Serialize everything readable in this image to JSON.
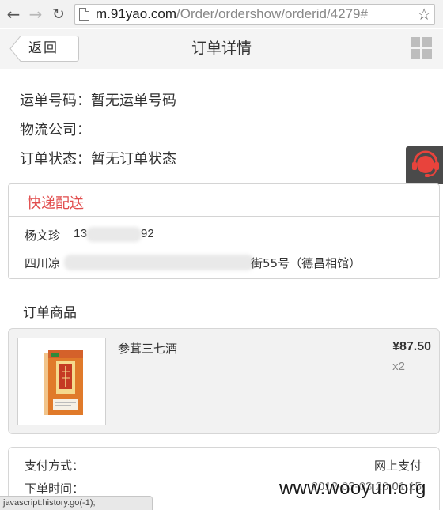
{
  "browser": {
    "url_host": "m.91yao.com",
    "url_path": "/Order/ordershow/orderid/4279#",
    "icons": {
      "back": "arrow-left-icon",
      "forward": "arrow-right-icon",
      "reload": "reload-icon",
      "page": "page-icon",
      "bookmark": "star-icon"
    }
  },
  "header": {
    "back_label": "返回",
    "title": "订单详情",
    "menu_icon": "grid-menu-icon"
  },
  "shipping": {
    "tracking_label": "运单号码：",
    "tracking_value": "暂无运单号码",
    "company_label": "物流公司：",
    "company_value": "",
    "status_label": "订单状态：",
    "status_value": "暂无订单状态"
  },
  "service_button": {
    "icon": "customer-service-headset-icon",
    "color": "#e8433c"
  },
  "delivery": {
    "title": "快递配送",
    "title_color": "#e14c4c",
    "name": "杨文珍",
    "phone_start": "13",
    "phone_end": "92",
    "address_start": "四川凉",
    "address_end": "街55号（德昌相馆）"
  },
  "products_section": {
    "heading": "订单商品",
    "items": [
      {
        "name": "参茸三七酒",
        "price": "¥87.50",
        "quantity": "x2",
        "image_label": "参茸三七酒"
      }
    ]
  },
  "payment": {
    "method_label": "支付方式：",
    "method_value": "网上支付",
    "time_label": "下单时间：",
    "time_value": "2012-03-03 20:01:15"
  },
  "status_bar": {
    "text": "javascript:history.go(-1);"
  },
  "watermark": {
    "text": "www.wooyun.org"
  }
}
